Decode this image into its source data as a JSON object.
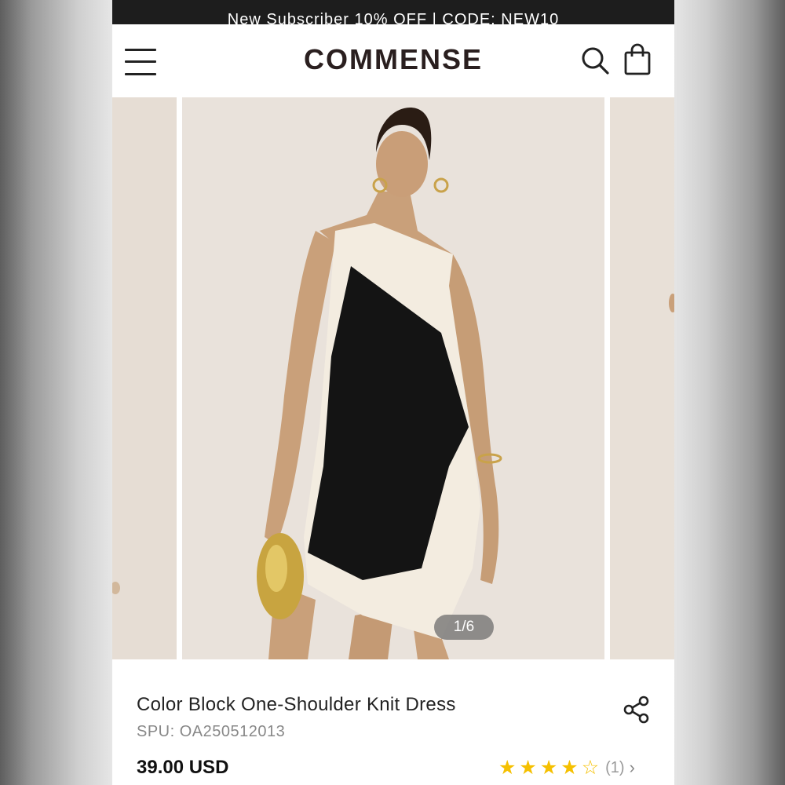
{
  "promo": {
    "text": "New Subscriber 10% OFF | CODE: NEW10"
  },
  "header": {
    "logo": "COMMENSE",
    "menu_icon": "hamburger-menu-icon",
    "search_icon": "search-icon",
    "bag_icon": "shopping-bag-icon"
  },
  "gallery": {
    "counter": "1/6"
  },
  "product": {
    "title": "Color Block One-Shoulder Knit Dress",
    "spu": "SPU: OA250512013",
    "price": "39.00 USD",
    "rating": 4,
    "rating_max": 5,
    "review_count": "(1)",
    "share_icon": "share-icon",
    "star_color": "#f5c000"
  }
}
